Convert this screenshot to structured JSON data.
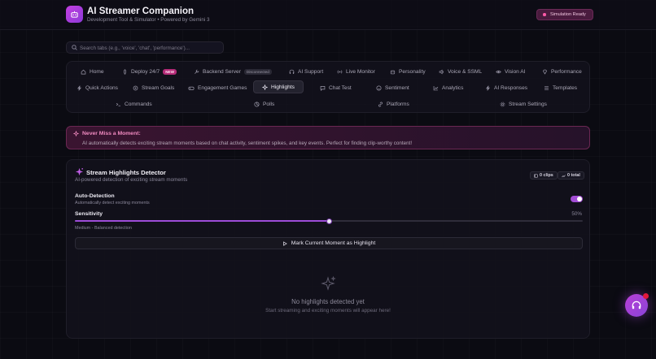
{
  "app": {
    "title": "AI Streamer Companion",
    "subtitle": "Development Tool & Simulator • Powered by Gemini 3",
    "status_badge": "Simulation Ready"
  },
  "search": {
    "placeholder": "Search tabs (e.g., 'voice', 'chat', 'performance')...",
    "value": ""
  },
  "tabs": {
    "row1": [
      {
        "label": "Home",
        "icon": "home-icon"
      },
      {
        "label": "Deploy 24/7",
        "icon": "rocket-icon",
        "badge": "NEW"
      },
      {
        "label": "Backend Server",
        "icon": "wrench-icon",
        "badge": "Disconnected"
      },
      {
        "label": "AI Support",
        "icon": "headset-icon"
      },
      {
        "label": "Live Monitor",
        "icon": "radio-icon"
      },
      {
        "label": "Personality",
        "icon": "bot-icon"
      },
      {
        "label": "Voice & SSML",
        "icon": "speaker-icon"
      },
      {
        "label": "Vision AI",
        "icon": "eye-icon"
      },
      {
        "label": "Performance",
        "icon": "gem-icon"
      }
    ],
    "row2": [
      {
        "label": "Quick Actions",
        "icon": "bolt-icon"
      },
      {
        "label": "Stream Goals",
        "icon": "target-icon"
      },
      {
        "label": "Engagement Games",
        "icon": "gamepad-icon"
      },
      {
        "label": "Highlights",
        "icon": "sparkle-icon",
        "active": true
      },
      {
        "label": "Chat Test",
        "icon": "chat-icon"
      },
      {
        "label": "Sentiment",
        "icon": "smile-icon"
      },
      {
        "label": "Analytics",
        "icon": "chart-icon"
      },
      {
        "label": "AI Responses",
        "icon": "bolt-icon"
      },
      {
        "label": "Templates",
        "icon": "list-icon"
      }
    ],
    "row3": [
      {
        "label": "Commands",
        "icon": "terminal-icon"
      },
      {
        "label": "Polls",
        "icon": "poll-icon"
      },
      {
        "label": "Platforms",
        "icon": "link-icon"
      },
      {
        "label": "Stream Settings",
        "icon": "gear-icon"
      }
    ]
  },
  "alert": {
    "title": "Never Miss a Moment:",
    "text": "AI automatically detects exciting stream moments based on chat activity, sentiment spikes, and key events. Perfect for finding clip-worthy content!"
  },
  "detector": {
    "title": "Stream Highlights Detector",
    "subtitle": "AI-powered detection of exciting stream moments",
    "clips_count": "0 clips",
    "total_count": "0 total",
    "auto_detection": {
      "label": "Auto-Detection",
      "description": "Automatically detect exciting moments",
      "enabled": true
    },
    "sensitivity": {
      "label": "Sensitivity",
      "value_text": "50%",
      "value": 0.5,
      "description": "Medium - Balanced detection"
    },
    "mark_button": "Mark Current Moment as Highlight",
    "empty_title": "No highlights detected yet",
    "empty_subtitle": "Start streaming and exciting moments will appear here!"
  },
  "colors": {
    "accent": "#a24dd4",
    "alert_title": "#f08ac0",
    "badge_new": "#b52c78"
  }
}
